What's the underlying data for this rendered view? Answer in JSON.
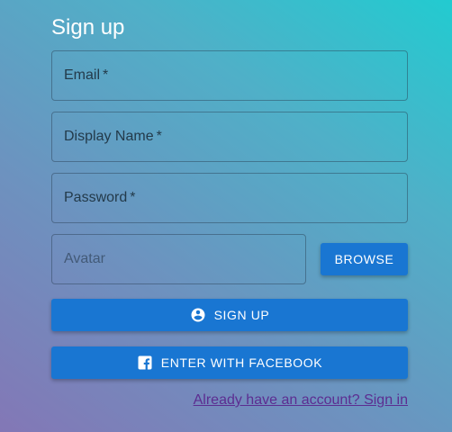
{
  "form": {
    "title": "Sign up",
    "fields": {
      "email": {
        "label": "Email",
        "required_mark": "*"
      },
      "display_name": {
        "label": "Display Name",
        "required_mark": "*"
      },
      "password": {
        "label": "Password",
        "required_mark": "*"
      },
      "avatar": {
        "placeholder": "Avatar"
      }
    },
    "buttons": {
      "browse": "BROWSE",
      "signup": "SIGN UP",
      "facebook": "ENTER WITH FACEBOOK"
    },
    "signin_link": "Already have an account? Sign in"
  },
  "icons": {
    "signup": "account-circle-icon",
    "facebook": "facebook-icon"
  },
  "colors": {
    "primary_button": "#1976d2",
    "link": "#5c2d91",
    "background_top_right": "#22cbd0",
    "background_bottom_left": "#8377b6"
  }
}
